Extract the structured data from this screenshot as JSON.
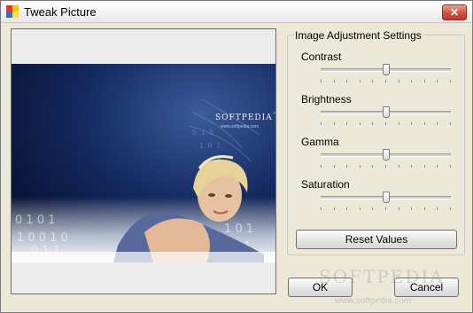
{
  "window": {
    "title": "Tweak Picture",
    "close_glyph": "✕"
  },
  "picture": {
    "brand_text": "SOFTPEDIA",
    "brand_trademark": "™",
    "url_text": "www.softpedia.com"
  },
  "settings": {
    "group_title": "Image Adjustment Settings",
    "sliders": [
      {
        "label": "Contrast",
        "value_fraction": 0.5
      },
      {
        "label": "Brightness",
        "value_fraction": 0.5
      },
      {
        "label": "Gamma",
        "value_fraction": 0.5
      },
      {
        "label": "Saturation",
        "value_fraction": 0.5
      }
    ],
    "reset_label": "Reset Values"
  },
  "buttons": {
    "ok_label": "OK",
    "cancel_label": "Cancel"
  },
  "watermark": {
    "text": "SOFTPEDIA",
    "url": "www.softpedia.com"
  },
  "colors": {
    "close_button": "#d0503a",
    "picture_bg": "#0d1f4a"
  }
}
